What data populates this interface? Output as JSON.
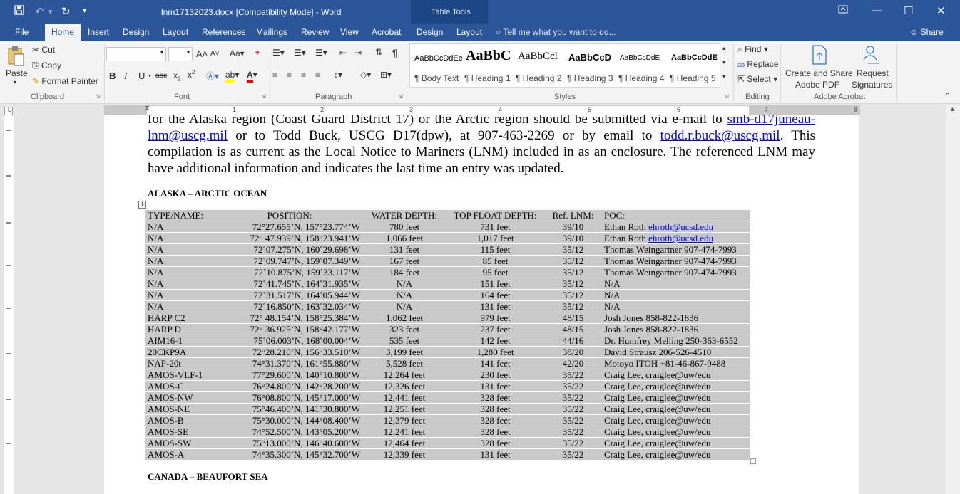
{
  "titlebar": {
    "title": "lnm17132023.docx [Compatibility Mode] - Word",
    "context_group": "Table Tools",
    "save_icon": "save-icon",
    "undo_icon": "undo-icon",
    "redo_icon": "redo-icon"
  },
  "tabs": [
    "File",
    "Home",
    "Insert",
    "Design",
    "Layout",
    "References",
    "Mailings",
    "Review",
    "View",
    "Acrobat",
    "Design",
    "Layout"
  ],
  "active_tab": "Home",
  "tellme": "Tell me what you want to do...",
  "share": "Share",
  "clipboard": {
    "paste": "Paste",
    "cut": "Cut",
    "copy": "Copy",
    "format_painter": "Format Painter",
    "label": "Clipboard"
  },
  "font": {
    "family": "",
    "size": "",
    "label": "Font"
  },
  "paragraph": {
    "label": "Paragraph"
  },
  "styles": {
    "label": "Styles",
    "items": [
      {
        "preview": "AaBbCcDdEe",
        "name": "¶ Body Text"
      },
      {
        "preview": "AaBbC",
        "name": "¶ Heading 1"
      },
      {
        "preview": "AaBbCcl",
        "name": "¶ Heading 2"
      },
      {
        "preview": "AaBbCcD",
        "name": "¶ Heading 3"
      },
      {
        "preview": "AaBbCcDdE",
        "name": "¶ Heading 4"
      },
      {
        "preview": "AaBbCcDdE",
        "name": "¶ Heading 5"
      }
    ]
  },
  "editing": {
    "find": "Find",
    "replace": "Replace",
    "select": "Select",
    "label": "Editing"
  },
  "acrobat": {
    "create_share_1": "Create and Share",
    "create_share_2": "Adobe PDF",
    "request_1": "Request",
    "request_2": "Signatures",
    "label": "Adobe Acrobat"
  },
  "ruler": [
    "1",
    "2",
    "3",
    "4",
    "5",
    "6",
    "7",
    "8"
  ],
  "document": {
    "line1": "for the Alaska region (Coast Guard District 17) or the Arctic region should be submitted via e-mail to ",
    "link1": "smb-d17juneau-lnm@uscg.mil",
    "line2a": " or to Todd Buck, USCG D17(dpw), at 907-463-2269 or by email to ",
    "link2": "todd.r.buck@uscg.mil",
    "line2b": ". This compilation is as current as the Local Notice to Mariners (LNM) included in as an enclosure. The referenced LNM may have additional information and indicates the last time an entry was updated.",
    "heading1": "ALASKA – ARCTIC OCEAN",
    "heading2": "CANADA – BEAUFORT SEA",
    "table_headers": [
      "TYPE/NAME:",
      "POSITION:",
      "WATER DEPTH:",
      "TOP FLOAT DEPTH:",
      "Ref. LNM:",
      "POC:"
    ],
    "rows": [
      [
        "N/A",
        "72°27.655’N, 157°23.774’W",
        "780 feet",
        "731 feet",
        "39/10",
        "Ethan Roth",
        "ehroth@ucsd.edu"
      ],
      [
        "N/A",
        "72° 47.939’N, 158°23.941’W",
        "1,066 feet",
        "1,017 feet",
        "39/10",
        "Ethan Roth",
        "ehroth@ucsd.edu"
      ],
      [
        "N/A",
        "72˚07.275’N, 160˚29.698’W",
        "131 feet",
        "115 feet",
        "35/12",
        "Thomas Weingartner 907-474-7993",
        ""
      ],
      [
        "N/A",
        "72˚09.747’N, 159˚07.349’W",
        "167 feet",
        "85 feet",
        "35/12",
        "Thomas Weingartner 907-474-7993",
        ""
      ],
      [
        "N/A",
        "72˚10.875’N, 159˚33.117’W",
        "184 feet",
        "95 feet",
        "35/12",
        "Thomas Weingartner 907-474-7993",
        ""
      ],
      [
        "N/A",
        "72˚41.745’N, 164˚31.935’W",
        "N/A",
        "151 feet",
        "35/12",
        "N/A",
        ""
      ],
      [
        "N/A",
        "72˚31.517’N, 164˚05.944’W",
        "N/A",
        "164 feet",
        "35/12",
        "N/A",
        ""
      ],
      [
        "N/A",
        "72˚16.850’N, 163˚32.034’W",
        "N/A",
        "131 feet",
        "35/12",
        "N/A",
        ""
      ],
      [
        "HARP C2",
        "72° 48.154’N, 158°25.384’W",
        "1,062 feet",
        "979 feet",
        "48/15",
        "Josh Jones 858-822-1836",
        ""
      ],
      [
        "HARP D",
        "72° 36.925’N, 158°42.177’W",
        "323 feet",
        "237 feet",
        "48/15",
        "Josh Jones 858-822-1836",
        ""
      ],
      [
        "AIM16-1",
        "75˚06.003’N, 168˚00.004’W",
        "535 feet",
        "142 feet",
        "44/16",
        "Dr. Humfrey Melling 250-363-6552",
        ""
      ],
      [
        "20CKP9A",
        "72°28.210’N, 156°33.510’W",
        "3,199 feet",
        "1,280 feet",
        "38/20",
        "David Strausz 206-526-4510",
        ""
      ],
      [
        "NAP-20t",
        "74°31.370’N, 161°55.880’W",
        "5,528 feet",
        "141 feet",
        "42/20",
        "Motoyo ITOH +81-46-867-9488",
        ""
      ],
      [
        "AMOS-VLF-1",
        "77°29.600’N, 140°10.800’W",
        "12,264 feet",
        "230 feet",
        "35/22",
        "Craig Lee, craiglee@uw/edu",
        ""
      ],
      [
        "AMOS-C",
        "76°24.800’N, 142°28.200’W",
        "12,326 feet",
        "131 feet",
        "35/22",
        "Craig Lee, craiglee@uw/edu",
        ""
      ],
      [
        "AMOS-NW",
        "76°08.800’N, 145°17.000’W",
        "12,441 feet",
        "328 feet",
        "35/22",
        "Craig Lee, craiglee@uw/edu",
        ""
      ],
      [
        "AMOS-NE",
        "75°46.400’N, 141°30.800’W",
        "12,251 feet",
        "328 feet",
        "35/22",
        "Craig Lee, craiglee@uw/edu",
        ""
      ],
      [
        "AMOS-B",
        "75°30.000’N, 144°08.400’W",
        "12,379 feet",
        "328 feet",
        "35/22",
        "Craig Lee, craiglee@uw/edu",
        ""
      ],
      [
        "AMOS-SE",
        "74°52.500’N, 143°05.200’W",
        "12,241 feet",
        "328 feet",
        "35/22",
        "Craig Lee, craiglee@uw/edu",
        ""
      ],
      [
        "AMOS-SW",
        "75°13.000’N, 146°40.600’W",
        "12,464 feet",
        "328 feet",
        "35/22",
        "Craig Lee, craiglee@uw/edu",
        ""
      ],
      [
        "AMOS-A",
        "74°35.300’N, 145°32.700’W",
        "12,339 feet",
        "131 feet",
        "35/22",
        "Craig Lee, craiglee@uw/edu",
        ""
      ]
    ]
  },
  "colors": {
    "ribbon_blue": "#2b579a",
    "table_grey": "#c9c9c9",
    "link": "#0000ee"
  }
}
